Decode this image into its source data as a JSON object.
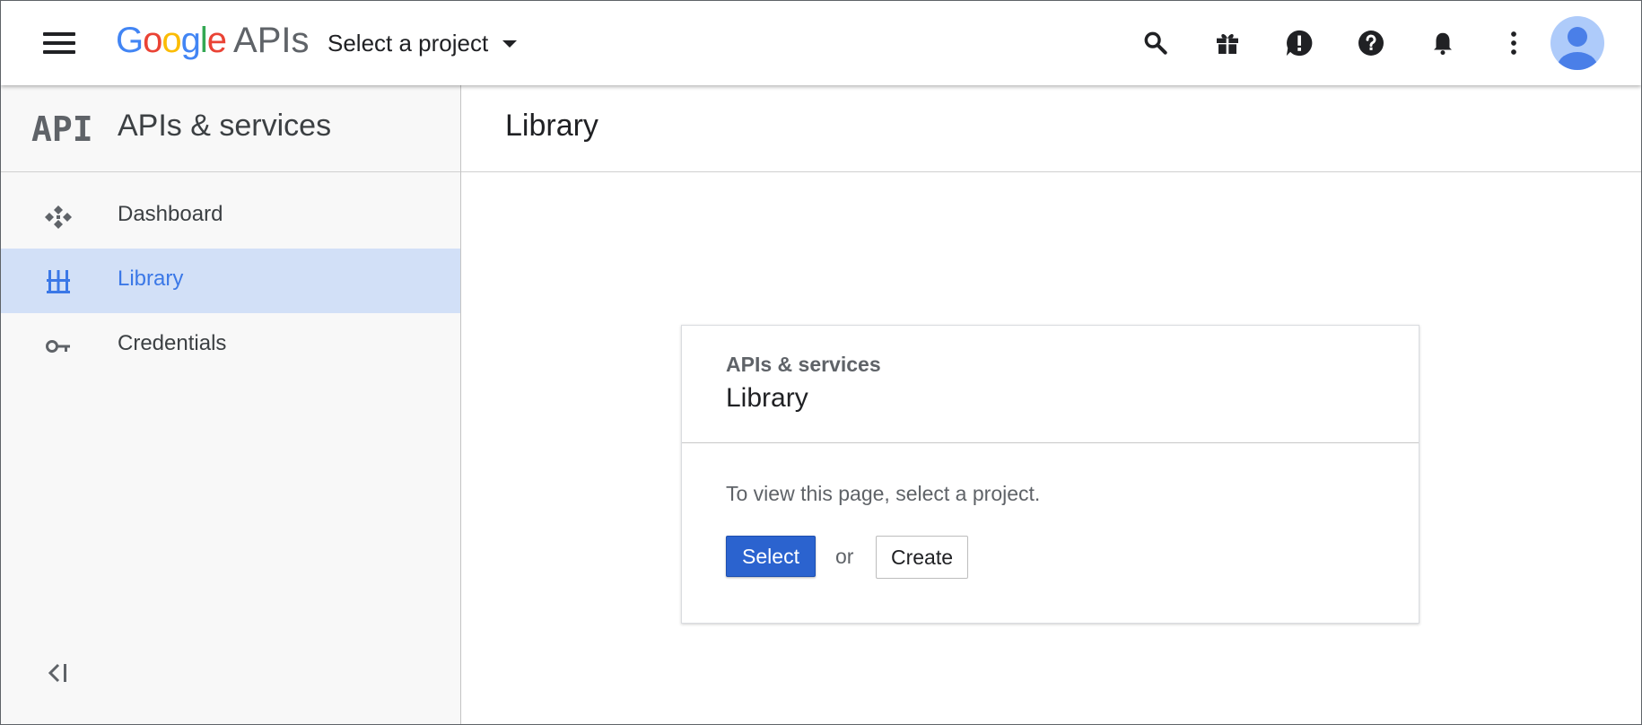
{
  "header": {
    "logo": {
      "letters": [
        "G",
        "o",
        "o",
        "g",
        "l",
        "e"
      ],
      "product": "APIs"
    },
    "project_picker_label": "Select a project",
    "icons": [
      "menu-icon",
      "search-icon",
      "gift-icon",
      "feedback-icon",
      "help-icon",
      "notifications-icon",
      "more-vert-icon",
      "account-avatar"
    ]
  },
  "sidebar": {
    "badge": "API",
    "title": "APIs & services",
    "items": [
      {
        "label": "Dashboard",
        "icon": "dashboard-icon",
        "active": false
      },
      {
        "label": "Library",
        "icon": "library-icon",
        "active": true
      },
      {
        "label": "Credentials",
        "icon": "key-icon",
        "active": false
      }
    ],
    "collapse_icon": "collapse-sidebar-icon"
  },
  "main": {
    "page_title": "Library",
    "card": {
      "overline": "APIs & services",
      "title": "Library",
      "message": "To view this page, select a project.",
      "select_label": "Select",
      "or_label": "or",
      "create_label": "Create"
    }
  },
  "colors": {
    "google_blue": "#4285f4",
    "google_red": "#ea4335",
    "google_yellow": "#fbbc05",
    "google_green": "#34a853",
    "active_nav_bg": "#d2e0f7",
    "active_nav_text": "#3b78e7",
    "primary_button": "#2b63cf",
    "avatar_bg": "#aecbfa",
    "avatar_fg": "#4a7fe8"
  }
}
